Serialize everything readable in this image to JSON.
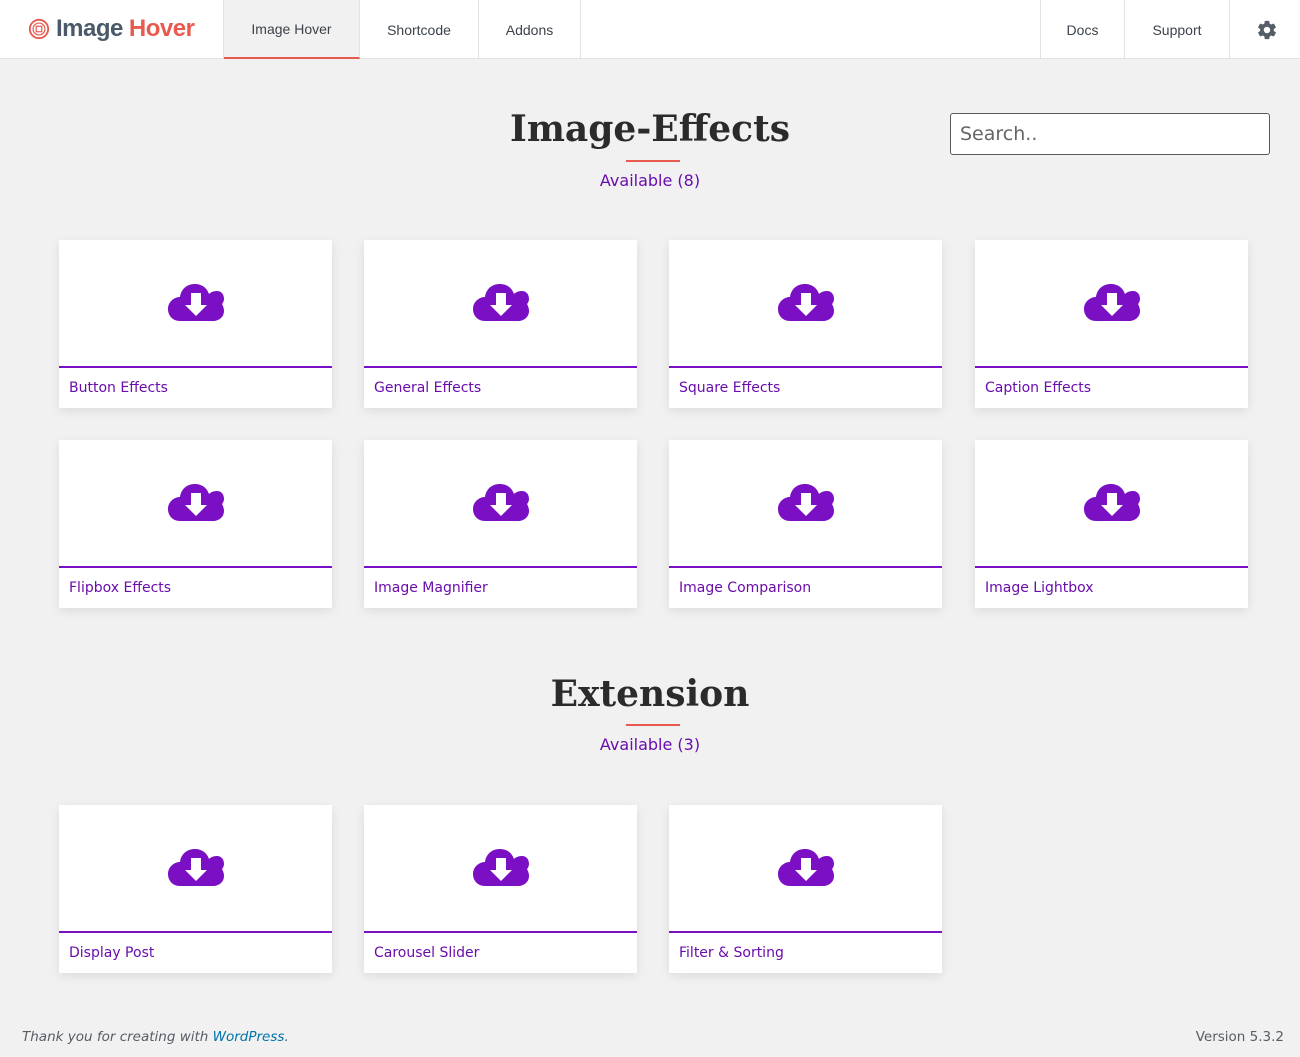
{
  "brand": {
    "word1": "Image",
    "word2": "Hover"
  },
  "nav": {
    "tabs": [
      {
        "label": "Image Hover",
        "active": true
      },
      {
        "label": "Shortcode",
        "active": false
      },
      {
        "label": "Addons",
        "active": false
      }
    ],
    "right": [
      {
        "label": "Docs"
      },
      {
        "label": "Support"
      }
    ],
    "settings_icon": "gear-icon"
  },
  "search": {
    "placeholder": "Search.."
  },
  "sections": [
    {
      "title": "Image-Effects",
      "available": "Available (8)",
      "cards": [
        {
          "label": "Button Effects"
        },
        {
          "label": "General Effects"
        },
        {
          "label": "Square Effects"
        },
        {
          "label": "Caption Effects"
        },
        {
          "label": "Flipbox Effects"
        },
        {
          "label": "Image Magnifier"
        },
        {
          "label": "Image Comparison"
        },
        {
          "label": "Image Lightbox"
        }
      ]
    },
    {
      "title": "Extension",
      "available": "Available (3)",
      "cards": [
        {
          "label": "Display Post"
        },
        {
          "label": "Carousel Slider"
        },
        {
          "label": "Filter & Sorting"
        }
      ]
    }
  ],
  "card_icon": "cloud-download-icon",
  "colors": {
    "accent": "#6a0dad",
    "underline": "#e85a4f",
    "card_border": "#7b0fc4"
  },
  "footer": {
    "thanks_prefix": "Thank you for creating with ",
    "thanks_link": "WordPress",
    "thanks_suffix": ".",
    "version": "Version 5.3.2"
  }
}
